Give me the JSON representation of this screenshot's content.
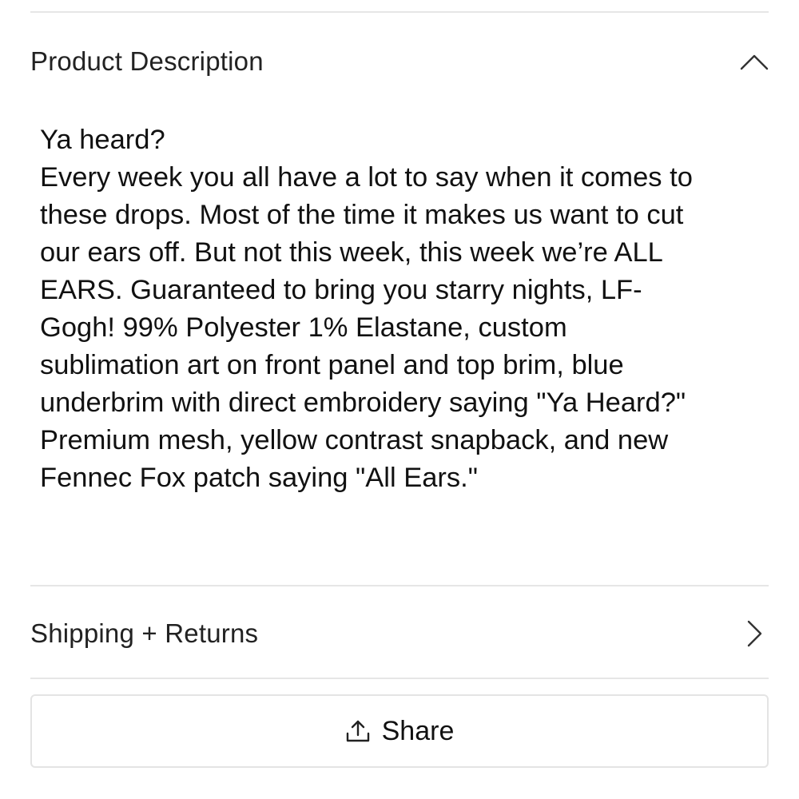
{
  "description_section": {
    "title": "Product Description",
    "expanded": true,
    "toggle_icon": "chevron-up-icon",
    "body_lines": [
      "Ya heard?",
      "Every week you all have a lot to say when it comes to",
      "these drops. Most of the time it makes us want to cut",
      "our ears off. But not this week, this week we’re ALL",
      "EARS. Guaranteed to bring you starry nights, LF-",
      "Gogh! 99% Polyester 1% Elastane, custom",
      "sublimation art on front panel and top brim, blue",
      "underbrim with direct embroidery saying \"Ya Heard?\"",
      "Premium mesh, yellow contrast snapback, and new",
      "Fennec Fox patch saying \"All Ears.\""
    ]
  },
  "shipping_section": {
    "title": "Shipping + Returns",
    "expanded": false,
    "toggle_icon": "chevron-right-icon"
  },
  "share_button": {
    "label": "Share",
    "icon": "share-icon"
  },
  "colors": {
    "text": "#1a1a1a",
    "divider": "#e6e6e6",
    "button_border": "#e4e4e4"
  }
}
